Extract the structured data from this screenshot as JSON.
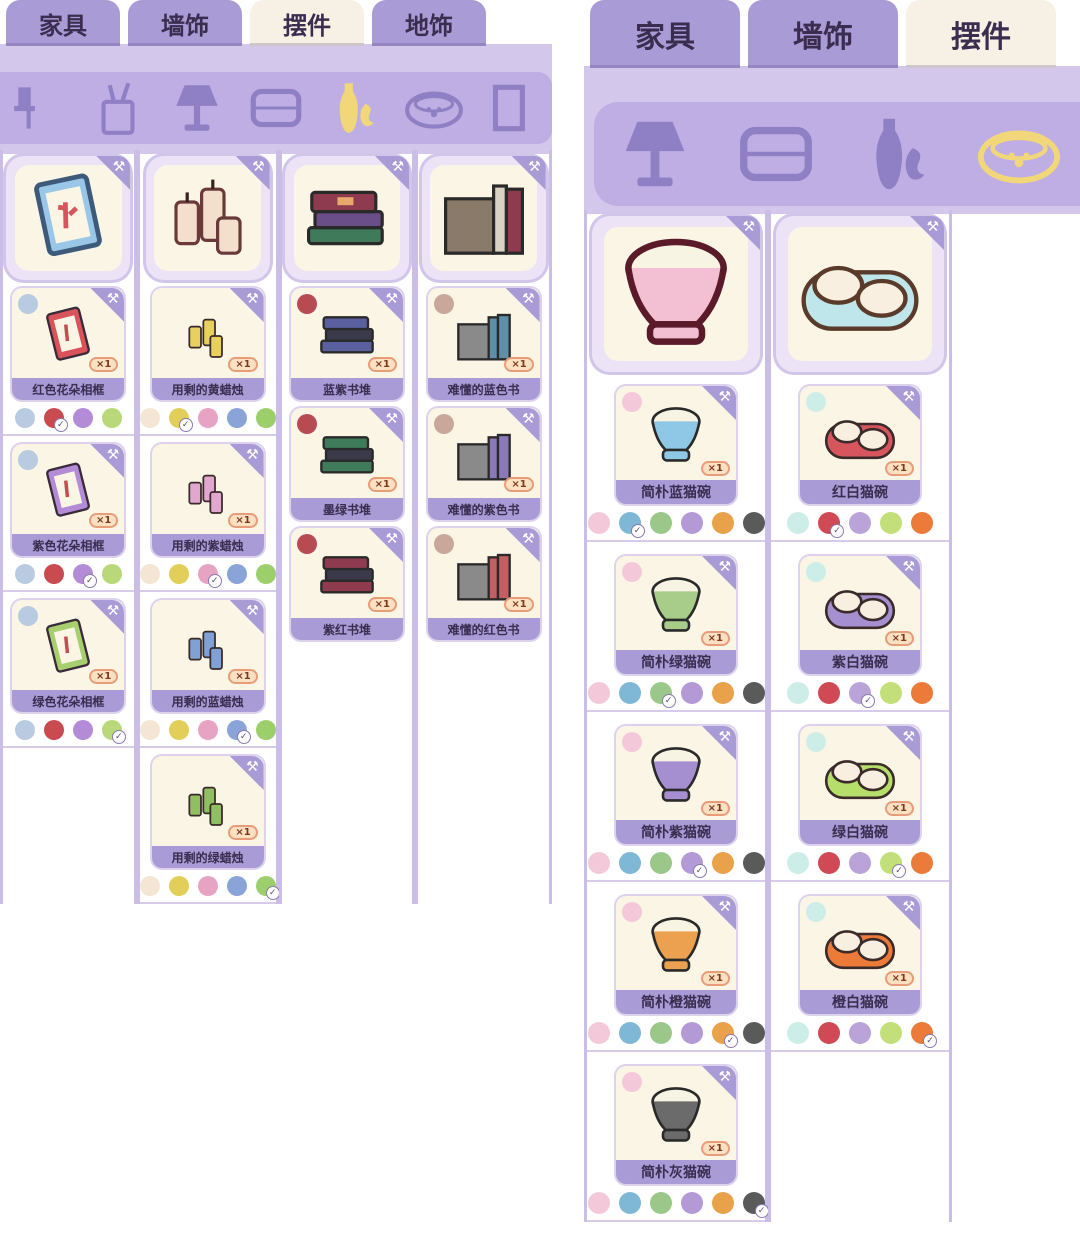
{
  "left": {
    "tabs": [
      {
        "label": "家具",
        "active": false
      },
      {
        "label": "墙饰",
        "active": false
      },
      {
        "label": "摆件",
        "active": true
      },
      {
        "label": "地饰",
        "active": false
      }
    ],
    "categories": [
      "chair-icon",
      "pen-holder-icon",
      "lamp-icon",
      "pillow-icon",
      "vase-icon",
      "pet-bowl-icon",
      "cup-icon"
    ],
    "active_category": "vase-icon",
    "columns": [
      {
        "set_icon": "photo-frame-icon",
        "items": [
          {
            "name": "红色花朵相框",
            "qty": "×1",
            "color": "#d9535a",
            "dot": "#b8cbe0",
            "swatches": [
              "#b8cbe0",
              "#c94a4f",
              "#b48bd6",
              "#b8d87a"
            ],
            "selected": 1
          },
          {
            "name": "紫色花朵相框",
            "qty": "×1",
            "color": "#b48bd6",
            "dot": "#b8cbe0",
            "swatches": [
              "#b8cbe0",
              "#c94a4f",
              "#b48bd6",
              "#b8d87a"
            ],
            "selected": 2
          },
          {
            "name": "绿色花朵相框",
            "qty": "×1",
            "color": "#a8cf6e",
            "dot": "#b8cbe0",
            "swatches": [
              "#b8cbe0",
              "#c94a4f",
              "#b48bd6",
              "#b8d87a"
            ],
            "selected": 3
          }
        ]
      },
      {
        "set_icon": "candles-icon",
        "items": [
          {
            "name": "用剩的黄蜡烛",
            "qty": "×1",
            "color": "#e7d060",
            "dot": "",
            "swatches": [
              "#f4e6d2",
              "#e2cf5a",
              "#e6a3c4",
              "#8aa4d8",
              "#9ccf6a"
            ],
            "selected": 1
          },
          {
            "name": "用剩的紫蜡烛",
            "qty": "×1",
            "color": "#e2a7cf",
            "dot": "",
            "swatches": [
              "#f4e6d2",
              "#e2cf5a",
              "#e6a3c4",
              "#8aa4d8",
              "#9ccf6a"
            ],
            "selected": 2
          },
          {
            "name": "用剩的蓝蜡烛",
            "qty": "×1",
            "color": "#7fa1d6",
            "dot": "",
            "swatches": [
              "#f4e6d2",
              "#e2cf5a",
              "#e6a3c4",
              "#8aa4d8",
              "#9ccf6a"
            ],
            "selected": 3
          },
          {
            "name": "用剩的绿蜡烛",
            "qty": "×1",
            "color": "#8fbf62",
            "dot": "",
            "swatches": [
              "#f4e6d2",
              "#e2cf5a",
              "#e6a3c4",
              "#8aa4d8",
              "#9ccf6a"
            ],
            "selected": 4
          }
        ]
      },
      {
        "set_icon": "book-stack-icon",
        "items": [
          {
            "name": "蓝紫书堆",
            "qty": "×1",
            "color": "#5a5f9e",
            "dot": "#b74a52",
            "swatches": [],
            "selected": -1
          },
          {
            "name": "墨绿书堆",
            "qty": "×1",
            "color": "#3f7a5a",
            "dot": "#b74a52",
            "swatches": [],
            "selected": -1
          },
          {
            "name": "紫红书堆",
            "qty": "×1",
            "color": "#8e3a4f",
            "dot": "#b74a52",
            "swatches": [],
            "selected": -1
          }
        ]
      },
      {
        "set_icon": "books-shelf-icon",
        "items": [
          {
            "name": "难懂的蓝色书",
            "qty": "×1",
            "color": "#5e8fa8",
            "dot": "#c9a79b",
            "swatches": [],
            "selected": -1
          },
          {
            "name": "难懂的紫色书",
            "qty": "×1",
            "color": "#8a78b8",
            "dot": "#c9a79b",
            "swatches": [],
            "selected": -1
          },
          {
            "name": "难懂的红色书",
            "qty": "×1",
            "color": "#c25f62",
            "dot": "#c9a79b",
            "swatches": [],
            "selected": -1
          }
        ]
      }
    ]
  },
  "right": {
    "tabs": [
      {
        "label": "家具",
        "active": false
      },
      {
        "label": "墙饰",
        "active": false
      },
      {
        "label": "摆件",
        "active": true
      }
    ],
    "categories": [
      "lamp-icon",
      "pillow-icon",
      "vase-icon",
      "pet-bowl-icon"
    ],
    "active_category": "pet-bowl-icon",
    "columns": [
      {
        "set_icon": "pink-cat-bowl-icon",
        "items": [
          {
            "name": "简朴蓝猫碗",
            "qty": "×1",
            "color": "#8ec8e6",
            "dot": "#f3c9d9",
            "swatches": [
              "#f3c9d9",
              "#7fb8d6",
              "#9cc78a",
              "#b39ad6",
              "#e9a14a",
              "#5a5a5a"
            ],
            "selected": 1
          },
          {
            "name": "简朴绿猫碗",
            "qty": "×1",
            "color": "#a8cc8a",
            "dot": "#f3c9d9",
            "swatches": [
              "#f3c9d9",
              "#7fb8d6",
              "#9cc78a",
              "#b39ad6",
              "#e9a14a",
              "#5a5a5a"
            ],
            "selected": 2
          },
          {
            "name": "简朴紫猫碗",
            "qty": "×1",
            "color": "#a58fd0",
            "dot": "#f3c9d9",
            "swatches": [
              "#f3c9d9",
              "#7fb8d6",
              "#9cc78a",
              "#b39ad6",
              "#e9a14a",
              "#5a5a5a"
            ],
            "selected": 3
          },
          {
            "name": "简朴橙猫碗",
            "qty": "×1",
            "color": "#eba14f",
            "dot": "#f3c9d9",
            "swatches": [
              "#f3c9d9",
              "#7fb8d6",
              "#9cc78a",
              "#b39ad6",
              "#e9a14a",
              "#5a5a5a"
            ],
            "selected": 4
          },
          {
            "name": "简朴灰猫碗",
            "qty": "×1",
            "color": "#6b6b6b",
            "dot": "#f3c9d9",
            "swatches": [
              "#f3c9d9",
              "#7fb8d6",
              "#9cc78a",
              "#b39ad6",
              "#e9a14a",
              "#5a5a5a"
            ],
            "selected": 5
          }
        ]
      },
      {
        "set_icon": "double-cat-bowl-icon",
        "items": [
          {
            "name": "红白猫碗",
            "qty": "×1",
            "color": "#d7565e",
            "dot": "#cdeee8",
            "swatches": [
              "#cdeee8",
              "#cf4a55",
              "#b9a3d8",
              "#c2df7a",
              "#ec7a38"
            ],
            "selected": 1
          },
          {
            "name": "紫白猫碗",
            "qty": "×1",
            "color": "#a58fd0",
            "dot": "#cdeee8",
            "swatches": [
              "#cdeee8",
              "#cf4a55",
              "#b9a3d8",
              "#c2df7a",
              "#ec7a38"
            ],
            "selected": 2
          },
          {
            "name": "绿白猫碗",
            "qty": "×1",
            "color": "#b5de6a",
            "dot": "#cdeee8",
            "swatches": [
              "#cdeee8",
              "#cf4a55",
              "#b9a3d8",
              "#c2df7a",
              "#ec7a38"
            ],
            "selected": 3
          },
          {
            "name": "橙白猫碗",
            "qty": "×1",
            "color": "#ec7a38",
            "dot": "#cdeee8",
            "swatches": [
              "#cdeee8",
              "#cf4a55",
              "#b9a3d8",
              "#c2df7a",
              "#ec7a38"
            ],
            "selected": 4
          }
        ]
      }
    ]
  }
}
